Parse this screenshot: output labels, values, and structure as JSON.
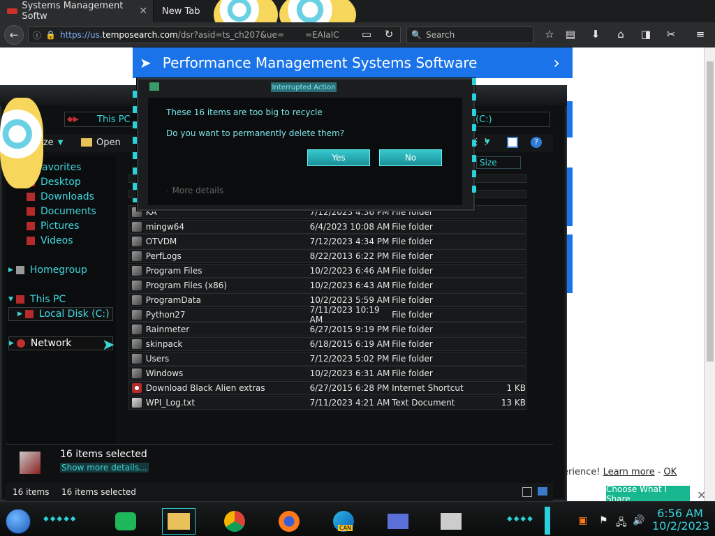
{
  "browser": {
    "tabs": [
      {
        "label": "Systems Management Softw",
        "active": true
      },
      {
        "label": "New Tab",
        "active": false
      }
    ],
    "url_prefix": "https://us.",
    "url_domain": "temposearch.com",
    "url_path": "/dsr?asid=ts_ch207&ue=",
    "url_suffix": "=EAIaIC",
    "search_placeholder": "Search"
  },
  "webpage": {
    "banner_title": "Performance Management Systems Software",
    "cookie_text": "erience!",
    "learn_more": "Learn more",
    "ok_link": "OK",
    "share_button": "Choose What I Share"
  },
  "explorer": {
    "address": "This PC",
    "address_drive": "(C:)",
    "toolbar": {
      "organize": "nize",
      "open": "Open"
    },
    "size_header": "Size",
    "sidebar": [
      {
        "label": "avorites",
        "icon": "star-icon"
      },
      {
        "label": "Desktop",
        "icon": "desktop-icon"
      },
      {
        "label": "Downloads",
        "icon": "downloads-icon"
      },
      {
        "label": "Documents",
        "icon": "documents-icon"
      },
      {
        "label": "Pictures",
        "icon": "pictures-icon"
      },
      {
        "label": "Videos",
        "icon": "videos-icon"
      },
      {
        "label": "Homegroup",
        "icon": "homegroup-icon"
      },
      {
        "label": "This PC",
        "icon": "computer-icon"
      },
      {
        "label": "Local Disk (C:)",
        "icon": "disk-icon"
      },
      {
        "label": "Network",
        "icon": "network-icon"
      }
    ],
    "rows": [
      {
        "name": "KA",
        "date": "7/12/2023 4:36 PM",
        "type": "File folder",
        "size": ""
      },
      {
        "name": "mingw64",
        "date": "6/4/2023 10:08 AM",
        "type": "File folder",
        "size": ""
      },
      {
        "name": "OTVDM",
        "date": "7/12/2023 4:34 PM",
        "type": "File folder",
        "size": ""
      },
      {
        "name": "PerfLogs",
        "date": "8/22/2013 6:22 PM",
        "type": "File folder",
        "size": ""
      },
      {
        "name": "Program Files",
        "date": "10/2/2023 6:46 AM",
        "type": "File folder",
        "size": ""
      },
      {
        "name": "Program Files (x86)",
        "date": "10/2/2023 6:43 AM",
        "type": "File folder",
        "size": ""
      },
      {
        "name": "ProgramData",
        "date": "10/2/2023 5:59 AM",
        "type": "File folder",
        "size": ""
      },
      {
        "name": "Python27",
        "date": "7/11/2023 10:19 AM",
        "type": "File folder",
        "size": ""
      },
      {
        "name": "Rainmeter",
        "date": "6/27/2015 9:19 PM",
        "type": "File folder",
        "size": ""
      },
      {
        "name": "skinpack",
        "date": "6/18/2015 6:19 AM",
        "type": "File folder",
        "size": ""
      },
      {
        "name": "Users",
        "date": "7/12/2023 5:02 PM",
        "type": "File folder",
        "size": ""
      },
      {
        "name": "Windows",
        "date": "10/2/2023 6:31 AM",
        "type": "File folder",
        "size": ""
      },
      {
        "name": "Download Black Alien extras",
        "date": "6/27/2015 6:28 PM",
        "type": "Internet Shortcut",
        "size": "1 KB"
      },
      {
        "name": "WPI_Log.txt",
        "date": "7/11/2023 4:21 AM",
        "type": "Text Document",
        "size": "13 KB"
      }
    ],
    "details_pane": {
      "selected": "16 items selected",
      "show_more": "Show more details..."
    },
    "status_bar": {
      "count": "16 items",
      "selected": "16 items selected"
    }
  },
  "dialog": {
    "title": "Interrupted Action",
    "line1": "These 16 items are too big to recycle",
    "line2": "Do you want to permanently delete them?",
    "yes": "Yes",
    "no": "No",
    "more_details": "More details"
  },
  "taskbar": {
    "time": "6:56 AM",
    "date": "10/2/2023",
    "edge_badge": "CAN"
  }
}
